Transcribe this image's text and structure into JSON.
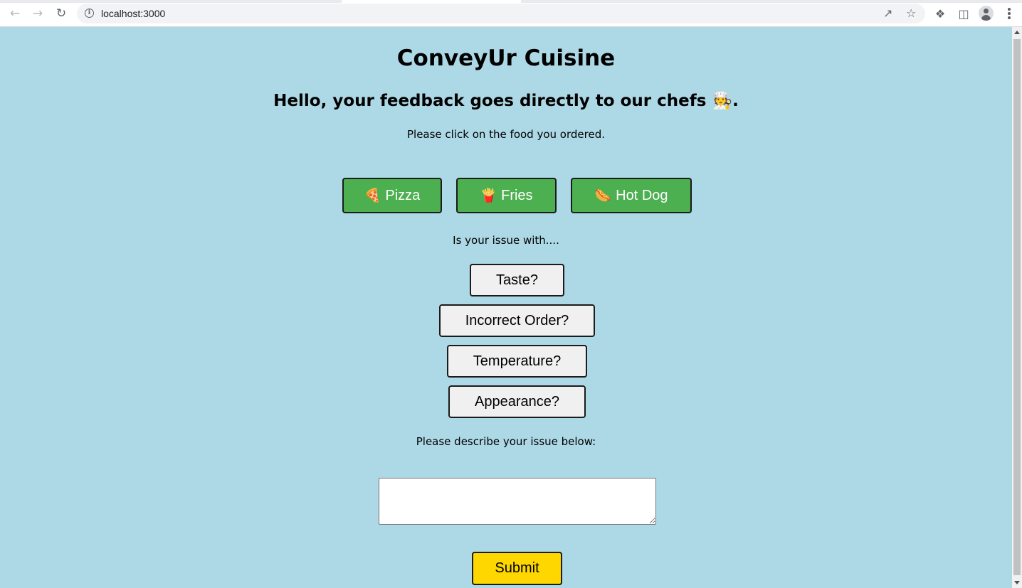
{
  "browser": {
    "url": "localhost:3000",
    "back_icon": "arrow-left-icon",
    "forward_icon": "arrow-right-icon",
    "reload_icon": "reload-icon"
  },
  "page": {
    "title": "ConveyUr Cuisine",
    "greeting": "Hello, your feedback goes directly to our chefs 🧑‍🍳.",
    "food_prompt": "Please click on the food you ordered.",
    "foods": [
      {
        "emoji": "🍕",
        "label": "Pizza"
      },
      {
        "emoji": "🍟",
        "label": "Fries"
      },
      {
        "emoji": "🌭",
        "label": "Hot Dog"
      }
    ],
    "issue_prompt": "Is your issue with....",
    "issues": [
      {
        "label": "Taste?"
      },
      {
        "label": "Incorrect Order?"
      },
      {
        "label": "Temperature?"
      },
      {
        "label": "Appearance?"
      }
    ],
    "describe_prompt": "Please describe your issue below:",
    "description_value": "",
    "submit_label": "Submit"
  },
  "colors": {
    "background": "#add8e6",
    "food_button": "#4caf50",
    "issue_button": "#f0f0f0",
    "submit_button": "#ffd700"
  }
}
